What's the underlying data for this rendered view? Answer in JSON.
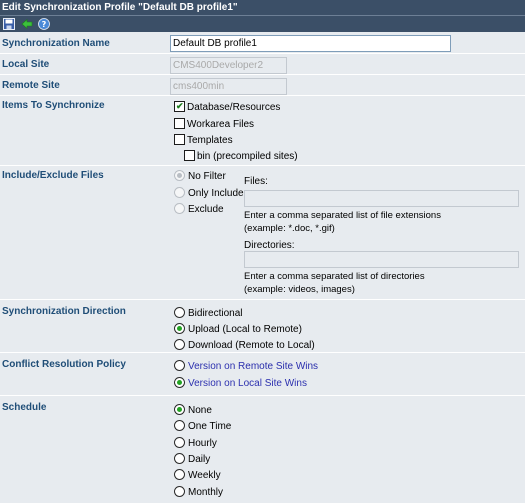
{
  "window": {
    "title": "Edit Synchronization Profile \"Default DB profile1\""
  },
  "toolbar": {
    "save_icon": "floppy-disk-icon",
    "back_icon": "green-back-arrow-icon",
    "help_icon": "help-icon"
  },
  "labels": {
    "sync_name": "Synchronization Name",
    "local_site": "Local Site",
    "remote_site": "Remote Site",
    "items": "Items To Synchronize",
    "include_exclude": "Include/Exclude Files",
    "direction": "Synchronization Direction",
    "conflict": "Conflict Resolution Policy",
    "schedule": "Schedule"
  },
  "fields": {
    "sync_name": "Default DB profile1",
    "local_site": "CMS400Developer2",
    "remote_site": "cms400min"
  },
  "items": {
    "database": {
      "label": "Database/Resources",
      "checked": true
    },
    "workarea": {
      "label": "Workarea Files",
      "checked": false
    },
    "templates": {
      "label": "Templates",
      "checked": false
    },
    "bin": {
      "label": "bin (precompiled sites)",
      "checked": false
    }
  },
  "filter": {
    "no_filter": "No Filter",
    "only_include": "Only Include",
    "exclude": "Exclude",
    "selected": "No Filter",
    "files_label": "Files:",
    "files_hint": "Enter a comma separated list of file extensions",
    "files_example": "(example: *.doc, *.gif)",
    "directories_label": "Directories:",
    "directories_hint": "Enter a comma separated list of directories",
    "directories_example": "(example: videos, images)"
  },
  "direction": {
    "bidirectional": "Bidirectional",
    "upload": "Upload (Local to Remote)",
    "download": "Download (Remote to Local)",
    "selected": "Upload (Local to Remote)"
  },
  "conflict": {
    "remote_wins": "Version on Remote Site Wins",
    "local_wins": "Version on Local Site Wins",
    "selected": "Version on Local Site Wins"
  },
  "schedule": {
    "none": "None",
    "one_time": "One Time",
    "hourly": "Hourly",
    "daily": "Daily",
    "weekly": "Weekly",
    "monthly": "Monthly",
    "selected": "None"
  },
  "colors": {
    "header_bg": "#3b4f67",
    "label_text": "#1f4d77",
    "link_text": "#2b2fae",
    "radio_dot": "#23a323",
    "check_mark": "#1e7d1e"
  }
}
